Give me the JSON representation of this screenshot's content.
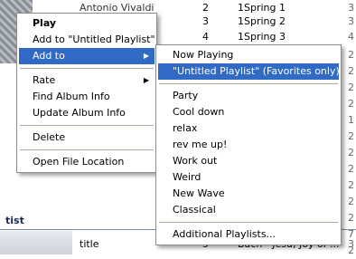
{
  "library": {
    "rows": [
      {
        "artist": "Antonio Vivaldi",
        "track": "2",
        "title": "1Spring 1",
        "extra": "3"
      },
      {
        "artist": "",
        "track": "3",
        "title": "1Spring 2",
        "extra": "3"
      },
      {
        "artist": "",
        "track": "4",
        "title": "1Spring 3",
        "extra": "4"
      }
    ],
    "edge_numbers": [
      "2",
      "2",
      "2",
      "2",
      "1",
      "2",
      "2",
      "2",
      "2",
      "2",
      "2",
      "7",
      "2"
    ],
    "section_label": "tist",
    "bottom_row": {
      "artist": "title",
      "track": "5",
      "title": "Bach - Jesu, Joy of ...",
      "extra": "3"
    }
  },
  "context_menu": {
    "items": [
      {
        "label": "Play",
        "bold": true
      },
      {
        "label": "Add to \"Untitled Playlist\""
      },
      {
        "label": "Add to",
        "has_submenu": true,
        "highlighted": true
      },
      {
        "separator": true
      },
      {
        "label": "Rate",
        "has_submenu": true
      },
      {
        "label": "Find Album Info"
      },
      {
        "label": "Update Album Info"
      },
      {
        "separator": true
      },
      {
        "label": "Delete"
      },
      {
        "separator": true
      },
      {
        "label": "Open File Location"
      }
    ]
  },
  "add_to_submenu": {
    "items": [
      {
        "label": "Now Playing"
      },
      {
        "label": "\"Untitled Playlist\" (Favorites only)",
        "highlighted": true
      },
      {
        "separator": true
      },
      {
        "label": "Party"
      },
      {
        "label": "Cool down"
      },
      {
        "label": "relax"
      },
      {
        "label": "rev me up!"
      },
      {
        "label": "Work out"
      },
      {
        "label": "Weird"
      },
      {
        "label": "New Wave"
      },
      {
        "label": "Classical"
      },
      {
        "separator": true
      },
      {
        "label": "Additional Playlists..."
      }
    ]
  },
  "colors": {
    "highlight": "#316ac5",
    "menu_border": "#8b8b8b",
    "separator": "#aca899"
  },
  "icons": {
    "submenu_arrow": "triangle-right-icon"
  }
}
